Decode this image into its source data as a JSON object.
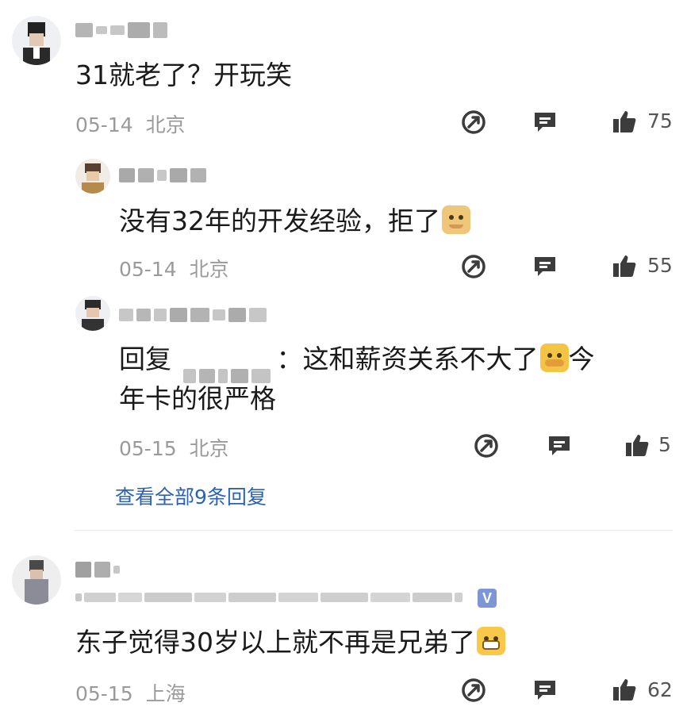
{
  "comments": [
    {
      "text": "31就老了？开玩笑",
      "date": "05-14",
      "location": "北京",
      "likes": "75",
      "replies": [
        {
          "text": "没有32年的开发经验，拒了",
          "emoji": "doge-emoji",
          "date": "05-14",
          "location": "北京",
          "likes": "55"
        },
        {
          "reply_prefix": "回复",
          "reply_colon": "：",
          "text_line1": "这和薪资关系不大了",
          "emoji": "cover-face-emoji",
          "text_line1_end": "今",
          "text_line2": "年卡的很严格",
          "date": "05-15",
          "location": "北京",
          "likes": "5"
        }
      ],
      "view_all": "查看全部9条回复"
    },
    {
      "text": "东子觉得30岁以上就不再是兄弟了",
      "emoji": "grin-emoji",
      "date": "05-15",
      "location": "上海",
      "likes": "62",
      "verified_badge": "V"
    }
  ],
  "colors": {
    "link": "#2b62b5",
    "meta": "#9a9a9a",
    "icon": "#3c3c3c",
    "badge": "#7d97d6"
  },
  "icons": [
    "share-icon",
    "comment-icon",
    "like-icon"
  ]
}
